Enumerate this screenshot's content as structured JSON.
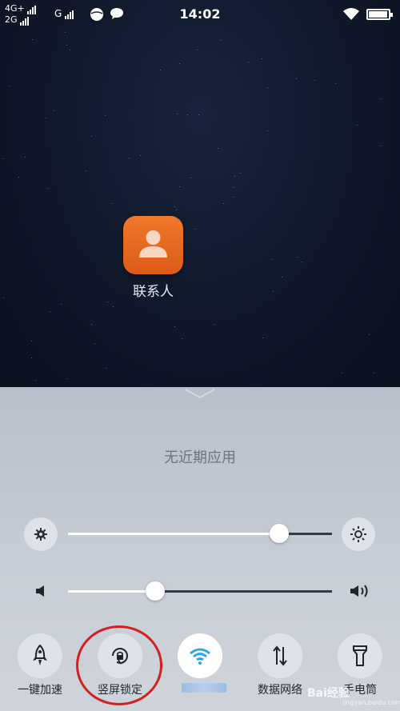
{
  "status_bar": {
    "network_primary": "4G+",
    "network_secondary": "2G",
    "network_sim2": "G",
    "time": "14:02",
    "battery_level": 0.95
  },
  "homescreen": {
    "app_label": "联系人",
    "app_icon": "contacts-person-icon"
  },
  "recent_panel": {
    "empty_text": "无近期应用"
  },
  "brightness": {
    "level": 0.8
  },
  "volume": {
    "level": 0.33
  },
  "toggles": [
    {
      "label": "一键加速",
      "icon": "rocket-icon",
      "active": false
    },
    {
      "label": "竖屏锁定",
      "icon": "rotation-lock-icon",
      "active": false
    },
    {
      "label": "",
      "icon": "wifi-icon",
      "active": true,
      "accent": "#2aa7e8"
    },
    {
      "label": "数据网络",
      "icon": "data-arrows-icon",
      "active": false
    },
    {
      "label": "手电筒",
      "icon": "flashlight-icon",
      "active": false
    }
  ],
  "watermark": {
    "text": "Bai经验",
    "sub": "jingyan.baidu.com"
  }
}
